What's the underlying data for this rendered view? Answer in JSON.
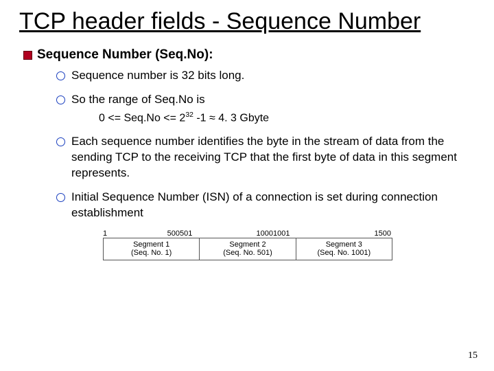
{
  "title": "TCP header fields - Sequence Number",
  "bullet_heading": "Sequence Number (Seq.No):",
  "subs": {
    "a": "Sequence number is 32 bits long.",
    "b": "So the range of Seq.No is",
    "b_line_pre": "0 <= Seq.No <= 2",
    "b_line_exp": "32",
    "b_line_post": " -1 ≈ 4. 3 Gbyte",
    "c": "Each  sequence number identifies the byte in the stream of data from the sending TCP to the receiving TCP that the first byte of data in this segment represents.",
    "d": "Initial Sequence Number (ISN) of a connection is set during connection establishment"
  },
  "seg_ticks": {
    "t1": "1",
    "t500": "500",
    "t501": "501",
    "t1000": "1000",
    "t1001": "1001",
    "t1500": "1500"
  },
  "segments": [
    {
      "name": "Segment 1",
      "seq": "(Seq. No. 1)"
    },
    {
      "name": "Segment 2",
      "seq": "(Seq. No. 501)"
    },
    {
      "name": "Segment 3",
      "seq": "(Seq. No. 1001)"
    }
  ],
  "page_number": "15"
}
